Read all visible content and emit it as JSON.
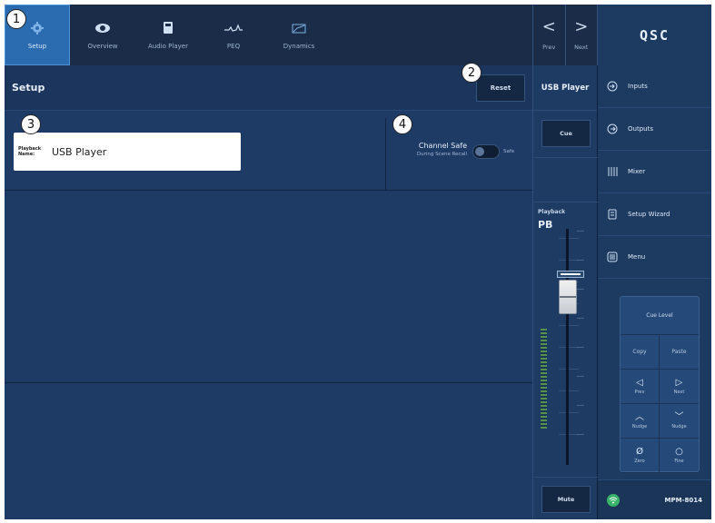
{
  "tabs": [
    {
      "label": "Setup",
      "icon": "gear-icon",
      "selected": true
    },
    {
      "label": "Overview",
      "icon": "eye-icon",
      "selected": false
    },
    {
      "label": "Audio Player",
      "icon": "audio-player-icon",
      "selected": false
    },
    {
      "label": "PEQ",
      "icon": "eq-curve-icon",
      "selected": false
    },
    {
      "label": "Dynamics",
      "icon": "dynamics-icon",
      "selected": false
    }
  ],
  "prev_next": {
    "prev_label": "Prev",
    "next_label": "Next",
    "prev_glyph": "<",
    "next_glyph": ">"
  },
  "logo": {
    "text": "QSC"
  },
  "header": {
    "title": "Setup",
    "reset_label": "Reset"
  },
  "playback_name": {
    "label": "Playback\nName:",
    "value": "USB Player"
  },
  "channel_safe": {
    "title": "Channel Safe",
    "subtitle": "During Scene Recall",
    "toggle_label": "Safe",
    "on": false
  },
  "badges": [
    "1",
    "2",
    "3",
    "4"
  ],
  "strip": {
    "name": "USB Player",
    "cue_label": "Cue",
    "channel_label": "Playback",
    "channel_id": "PB",
    "unity_mark": "U",
    "mute_label": "Mute"
  },
  "nav": [
    {
      "label": "Inputs",
      "icon": "inputs-icon"
    },
    {
      "label": "Outputs",
      "icon": "outputs-icon"
    },
    {
      "label": "Mixer",
      "icon": "mixer-icon"
    },
    {
      "label": "Setup Wizard",
      "icon": "wizard-icon"
    },
    {
      "label": "Menu",
      "icon": "menu-icon"
    }
  ],
  "cue_level": {
    "title": "Cue Level",
    "buttons": [
      {
        "glyph": "",
        "label": "Copy"
      },
      {
        "glyph": "",
        "label": "Paste"
      },
      {
        "glyph": "◁",
        "label": "Prev"
      },
      {
        "glyph": "▷",
        "label": "Next"
      },
      {
        "glyph": "︿",
        "label": "Nudge"
      },
      {
        "glyph": "﹀",
        "label": "Nudge"
      },
      {
        "glyph": "Ø",
        "label": "Zero"
      },
      {
        "glyph": "○",
        "label": "Fine"
      }
    ]
  },
  "footer": {
    "device": "MPM-8014"
  },
  "colors": {
    "selected_tab": "#2b6bb0",
    "background": "#1c3760",
    "wifi": "#39b36a"
  }
}
